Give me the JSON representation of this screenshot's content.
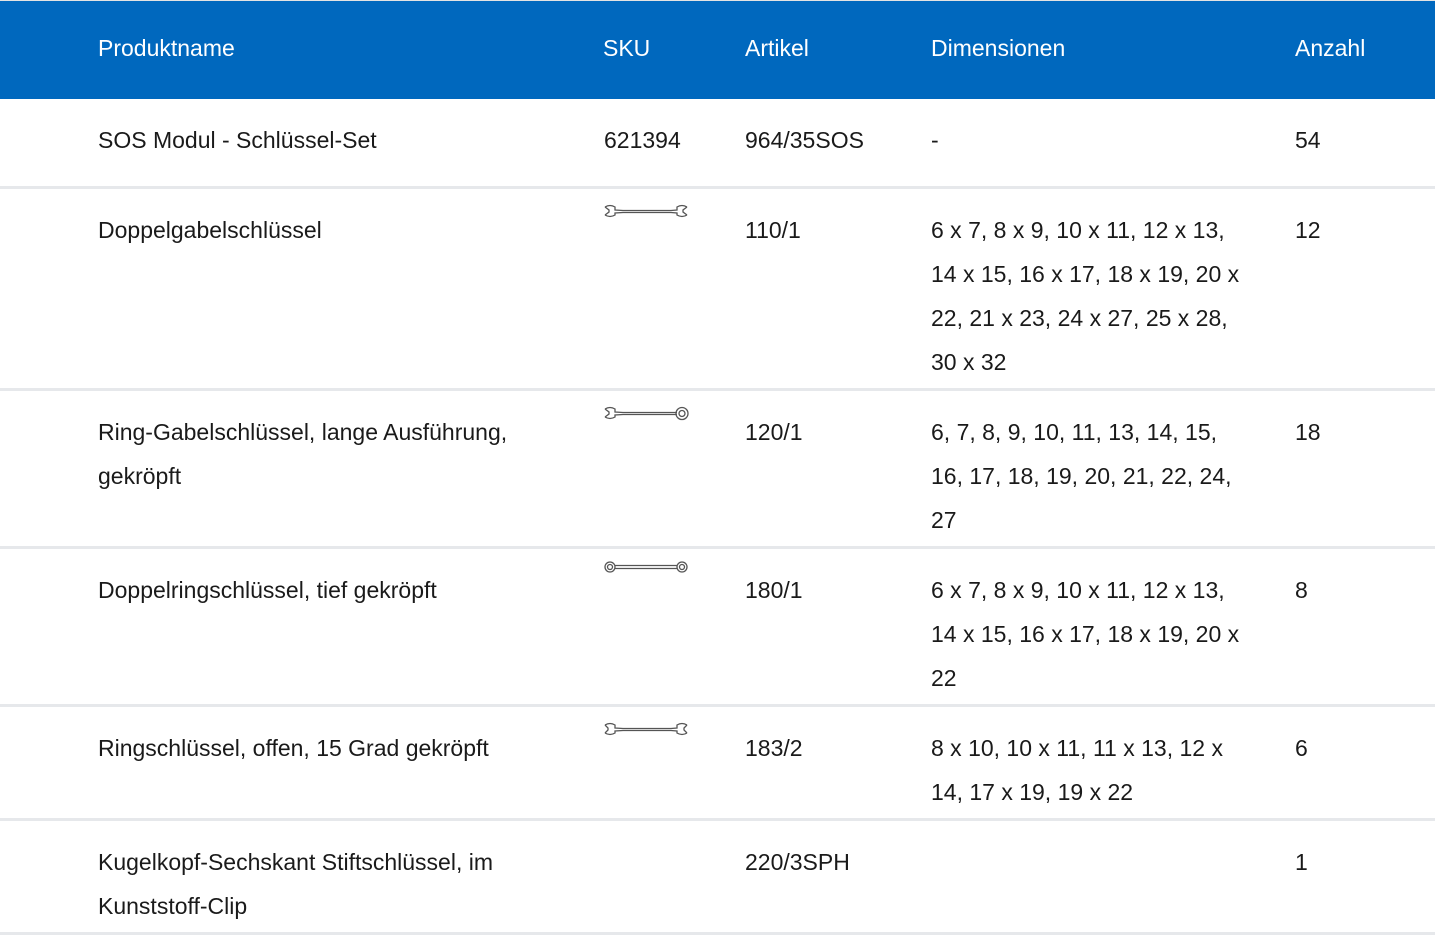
{
  "headers": {
    "product": "Produktname",
    "sku": "SKU",
    "article": "Artikel",
    "dimensions": "Dimensionen",
    "quantity": "Anzahl"
  },
  "colors": {
    "header_bg": "#0068be",
    "header_text": "#ffffff",
    "row_divider": "#e6e8eb",
    "body_text": "#1a1a1a"
  },
  "rows": [
    {
      "product": "SOS Modul - Schlüssel-Set",
      "sku": "621394",
      "sku_icon": "",
      "article": "964/35SOS",
      "dimensions": "-",
      "quantity": "54"
    },
    {
      "product": "Doppelgabelschlüssel",
      "sku": "",
      "sku_icon": "double-open-end-wrench-icon",
      "article": "110/1",
      "dimensions": "6 x 7, 8 x 9, 10 x 11, 12 x 13, 14 x 15, 16 x 17, 18 x 19, 20 x 22, 21 x 23, 24 x 27, 25 x 28, 30 x 32",
      "quantity": "12"
    },
    {
      "product": "Ring-Gabelschlüssel, lange Ausführung, gekröpft",
      "sku": "",
      "sku_icon": "combination-wrench-icon",
      "article": "120/1",
      "dimensions": "6, 7, 8, 9, 10, 11, 13, 14, 15, 16, 17, 18, 19, 20, 21, 22, 24, 27",
      "quantity": "18"
    },
    {
      "product": "Doppelringschlüssel, tief gekröpft",
      "sku": "",
      "sku_icon": "double-ring-wrench-icon",
      "article": "180/1",
      "dimensions": "6 x 7, 8 x 9, 10 x 11, 12 x 13, 14 x 15, 16 x 17, 18 x 19, 20 x 22",
      "quantity": "8"
    },
    {
      "product": "Ringschlüssel, offen, 15 Grad gekröpft",
      "sku": "",
      "sku_icon": "flare-nut-wrench-icon",
      "article": "183/2",
      "dimensions": "8 x 10, 10 x 11, 11 x 13, 12 x 14, 17 x 19, 19 x 22",
      "quantity": "6"
    },
    {
      "product": "Kugelkopf-Sechskant Stiftschlüssel, im Kunststoff-Clip",
      "sku": "",
      "sku_icon": "",
      "article": "220/3SPH",
      "dimensions": "",
      "quantity": "1"
    }
  ]
}
